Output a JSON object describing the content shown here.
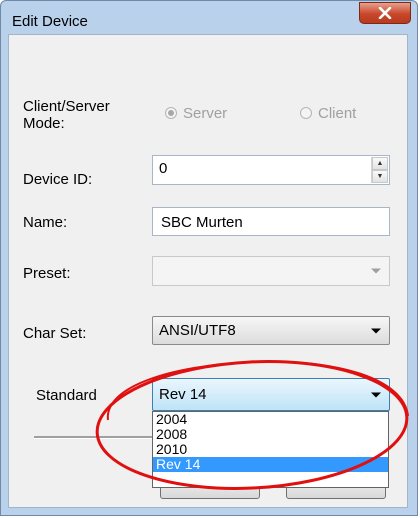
{
  "window": {
    "title": "Edit Device"
  },
  "mode": {
    "label": "Client/Server Mode:",
    "options": [
      {
        "label": "Server",
        "checked": true
      },
      {
        "label": "Client",
        "checked": false
      }
    ]
  },
  "device_id": {
    "label": "Device ID:",
    "value": "0"
  },
  "name": {
    "label": "Name:",
    "value": "SBC Murten"
  },
  "preset": {
    "label": "Preset:",
    "value": ""
  },
  "charset": {
    "label": "Char Set:",
    "value": "ANSI/UTF8"
  },
  "standard": {
    "label": "Standard",
    "value": "Rev 14",
    "options": [
      "2004",
      "2008",
      "2010",
      "Rev 14"
    ]
  },
  "colors": {
    "annotation": "#e01010",
    "selection": "#3399ff"
  }
}
